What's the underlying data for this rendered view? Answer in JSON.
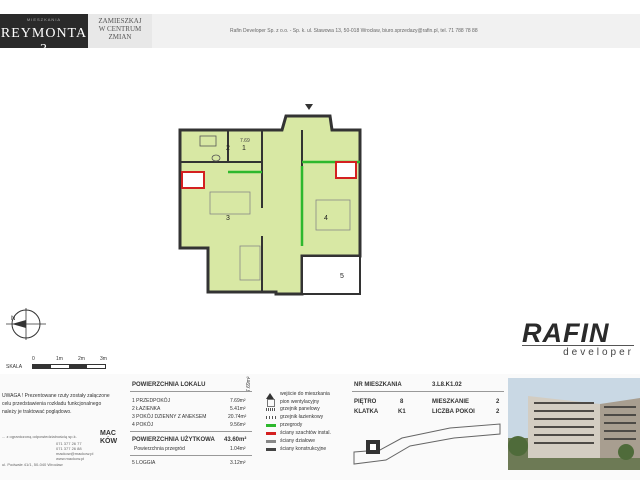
{
  "header": {
    "logo_small": "MIESZKANIA",
    "logo_title": "REYMONTA 3",
    "slogan": [
      "ZAMIESZKAJ",
      "W CENTRUM",
      "ZMIAN"
    ],
    "contact": "Rafin Developer Sp. z o.o. - Sp. k.  ul. Stawowa 13, 50-018 Wrocław, biuro.sprzedazy@rafin.pl, tel. 71 788 78 88"
  },
  "plan": {
    "rooms": [
      {
        "num": "1",
        "area": "7.69"
      },
      {
        "num": "2",
        "area": ""
      },
      {
        "num": "3",
        "area": ""
      },
      {
        "num": "4",
        "area": ""
      },
      {
        "num": "5",
        "area": ""
      }
    ]
  },
  "scale": {
    "label": "SKALA",
    "ticks": [
      "0",
      "1m",
      "2m",
      "3m"
    ]
  },
  "compass": {
    "north": "N"
  },
  "brand": {
    "name": "RAFIN",
    "sub": "developer"
  },
  "disclaimer": [
    "UWAGA ! Prezentowane rzuty zostały załączone",
    "celu przedstawienia rozkładu funkcjonalnego",
    "należy je traktować poglądowo."
  ],
  "designer": {
    "lines": [
      "... z ograniczoną odpowiedzialnością sp.k.",
      "071 377 26 77",
      "071 377 26 88",
      "mackow@mackow.pl",
      "www.mackow.pl",
      "ul. Podwale 41/1, 50-040 Wrocław"
    ],
    "mark": "MAC KÓW"
  },
  "areas": {
    "header": "POWIERZCHNIA LOKALU",
    "header_value": "7.69m²",
    "rows": [
      {
        "label": "1 PRZEDPOKÓJ",
        "value": "7.69m²"
      },
      {
        "label": "2 ŁAZIENKA",
        "value": "5.41m²"
      },
      {
        "label": "3 POKÓJ DZIENNY Z ANEKSEM",
        "value": "20.74m²"
      },
      {
        "label": "4 POKÓJ",
        "value": "9.56m²"
      }
    ],
    "usable_label": "POWIERZCHNIA UŻYTKOWA",
    "usable_value": "43.60m²",
    "partitions_label": "Powierzchnia przegród",
    "partitions_value": "1.04m²",
    "loggia_label": "5 LOGGIA",
    "loggia_value": "3.12m²"
  },
  "legend": [
    {
      "label": "wejście do mieszkania",
      "color": "#333333"
    },
    {
      "label": "pion wentylacyjny",
      "color": "#777777"
    },
    {
      "label": "grzejnik panelowy",
      "color": "#555555"
    },
    {
      "label": "grzejnik łazienkowy",
      "color": "#555555"
    },
    {
      "label": "przegrody",
      "color": "#2db82d"
    },
    {
      "label": "ściany szachtów instal.",
      "color": "#d42020"
    },
    {
      "label": "ściany działowe",
      "color": "#888888"
    },
    {
      "label": "ściany konstrukcyjne",
      "color": "#444444"
    }
  ],
  "apartment": {
    "nr_label": "NR MIESZKANIA",
    "nr_value": "3.L8.K1.02",
    "floor_label": "PIĘTRO",
    "floor_value": "8",
    "unit_label": "MIESZKANIE",
    "unit_value": "2",
    "stair_label": "KLATKA",
    "stair_value": "K1",
    "rooms_label": "LICZBA POKOI",
    "rooms_value": "2"
  },
  "colors": {
    "floor": "#d8e8a4",
    "wall": "#333333",
    "partition": "#2db82d",
    "shaft": "#d42020"
  }
}
